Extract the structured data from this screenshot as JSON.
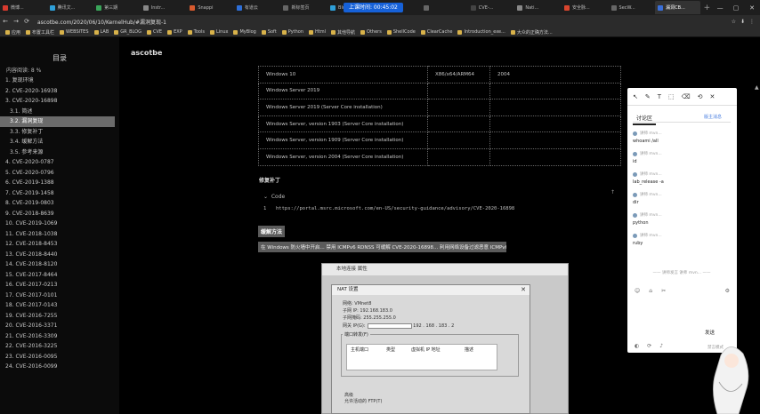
{
  "browser": {
    "tabs": [
      "微博...",
      "腾讯文...",
      "第三期",
      "Instr...",
      "Snappi",
      "有道云",
      "新标签页",
      "Blueri...",
      "上课倒",
      "",
      "CVE-...",
      "Nati...",
      "安全脉...",
      "SecW...",
      "漏洞CB..."
    ],
    "active_tab_index": 14,
    "tab_colors": [
      "#d83a2e",
      "#2e9fd8",
      "#3aa55a",
      "#888888",
      "#d85a2e",
      "#2e6fd8",
      "#666666",
      "#2e9fd8",
      "#1661d8",
      "#666666",
      "#444444",
      "#888888",
      "#d8452e",
      "#666666",
      "#3a6fd8"
    ],
    "new_tab": "+",
    "clock": "上课时间: 00:45:02",
    "window_controls": [
      "—",
      "▢",
      "✕"
    ],
    "nav": [
      "←",
      "→",
      "⟳"
    ],
    "url": "ascotbe.com/2020/06/10/KernelHub/#漏洞复现-1",
    "addr_icons": [
      "☆",
      "⬇",
      "⋮"
    ],
    "bookmarks": [
      "应用",
      "布置工具栏",
      "WEBSITES",
      "LAB",
      "GR_BLOG",
      "CVE",
      "EXP",
      "Tools",
      "Linux",
      "MyBlog",
      "Soft",
      "Python",
      "Html",
      "其他导航",
      "Others",
      "ShellCode",
      "ClearCache",
      "Introduction_exe...",
      "大众的正确方法..."
    ]
  },
  "site": {
    "title": "ascotbe"
  },
  "sidebar": {
    "title": "目录",
    "subtitle": "内容阅读: 8 %",
    "items": [
      {
        "label": "1. 复现环境",
        "sub": false,
        "active": false
      },
      {
        "label": "2. CVE-2020-16938",
        "sub": false,
        "active": false
      },
      {
        "label": "3. CVE-2020-16898",
        "sub": false,
        "active": false
      },
      {
        "label": "3.1. 简述",
        "sub": true,
        "active": false
      },
      {
        "label": "3.2. 漏洞复现",
        "sub": true,
        "active": true
      },
      {
        "label": "3.3. 修复补丁",
        "sub": true,
        "active": false
      },
      {
        "label": "3.4. 缓解方法",
        "sub": true,
        "active": false
      },
      {
        "label": "3.5. 参考来源",
        "sub": true,
        "active": false
      },
      {
        "label": "4. CVE-2020-0787",
        "sub": false,
        "active": false
      },
      {
        "label": "5. CVE-2020-0796",
        "sub": false,
        "active": false
      },
      {
        "label": "6. CVE-2019-1388",
        "sub": false,
        "active": false
      },
      {
        "label": "7. CVE-2019-1458",
        "sub": false,
        "active": false
      },
      {
        "label": "8. CVE-2019-0803",
        "sub": false,
        "active": false
      },
      {
        "label": "9. CVE-2018-8639",
        "sub": false,
        "active": false
      },
      {
        "label": "10. CVE-2019-1069",
        "sub": false,
        "active": false
      },
      {
        "label": "11. CVE-2018-1038",
        "sub": false,
        "active": false
      },
      {
        "label": "12. CVE-2018-8453",
        "sub": false,
        "active": false
      },
      {
        "label": "13. CVE-2018-8440",
        "sub": false,
        "active": false
      },
      {
        "label": "14. CVE-2018-8120",
        "sub": false,
        "active": false
      },
      {
        "label": "15. CVE-2017-8464",
        "sub": false,
        "active": false
      },
      {
        "label": "16. CVE-2017-0213",
        "sub": false,
        "active": false
      },
      {
        "label": "17. CVE-2017-0101",
        "sub": false,
        "active": false
      },
      {
        "label": "18. CVE-2017-0143",
        "sub": false,
        "active": false
      },
      {
        "label": "19. CVE-2016-7255",
        "sub": false,
        "active": false
      },
      {
        "label": "20. CVE-2016-3371",
        "sub": false,
        "active": false
      },
      {
        "label": "21. CVE-2016-3309",
        "sub": false,
        "active": false
      },
      {
        "label": "22. CVE-2016-3225",
        "sub": false,
        "active": false
      },
      {
        "label": "23. CVE-2016-0095",
        "sub": false,
        "active": false
      },
      {
        "label": "24. CVE-2016-0099",
        "sub": false,
        "active": false
      }
    ]
  },
  "article": {
    "table_rows": [
      [
        "Windows 10",
        "X86/x64/ARM64",
        "2004"
      ],
      [
        "Windows Server 2019",
        "",
        ""
      ],
      [
        "Windows Server 2019 (Server Core installation)",
        "",
        ""
      ],
      [
        "Windows Server, version 1903 (Server Core installation)",
        "",
        ""
      ],
      [
        "Windows Server, version 1909 (Server Core installation)",
        "",
        ""
      ],
      [
        "Windows Server, version 2004 (Server Core installation)",
        "",
        ""
      ]
    ],
    "heading": "修复补丁",
    "code_lang": "Code",
    "code_line_no": "1",
    "code_text": "https://portal.msrc.microsoft.com/en-US/security-guidance/advisory/CVE-2020-16898",
    "highlight_title": "缓解方法",
    "highlight_text": "在 Windows 防火墙中开启...   禁用 ICMPv6 RDNSS 可缓解 CVE-2020-16898... 利用网络设备过滤恶意 ICMPv6 数据包"
  },
  "dialog_back": {
    "title": "本地连接 属性"
  },
  "dialog": {
    "title": "NAT 设置",
    "fields": [
      {
        "label": "网络:",
        "value": "VMnet8"
      },
      {
        "label": "子网 IP:",
        "value": "192.168.183.0"
      },
      {
        "label": "子网掩码:",
        "value": "255.255.255.0"
      },
      {
        "label": "网关 IP(G):",
        "value": "192 . 168 . 183 . 2"
      }
    ],
    "group_title": "端口转发(F)",
    "grid_cols": [
      "主机端口",
      "类型",
      "虚拟机 IP 地址",
      "描述"
    ],
    "footer1": "高级",
    "footer2": "允许活动的 FTP(T)"
  },
  "comments": {
    "toolbar": [
      "↖",
      "✎",
      "T",
      "⬚",
      "⌫",
      "⟲",
      "✕"
    ],
    "tab_active": "讨论区",
    "tab_other": "版主消息",
    "messages": [
      {
        "who": "讲师 mvn...",
        "text": "whoami /all"
      },
      {
        "who": "讲师 mvn...",
        "text": "id"
      },
      {
        "who": "讲师 mvn...",
        "text": "lab_release -a"
      },
      {
        "who": "讲师 mvn...",
        "text": "dir"
      },
      {
        "who": "讲师 mvn...",
        "text": "python"
      },
      {
        "who": "讲师 mvn...",
        "text": "ruby"
      }
    ],
    "footer_note": "—— 讲师发言 讲师 mvn... ——",
    "send": "发送",
    "bottom_note": "禁言模式",
    "icons_left": [
      "☺",
      "⌂",
      "✂"
    ],
    "icon_right": "⚙",
    "bottom_icons": [
      "◐",
      "⟳",
      "♪"
    ]
  },
  "scroll_up": "▲",
  "to_top": "↑"
}
